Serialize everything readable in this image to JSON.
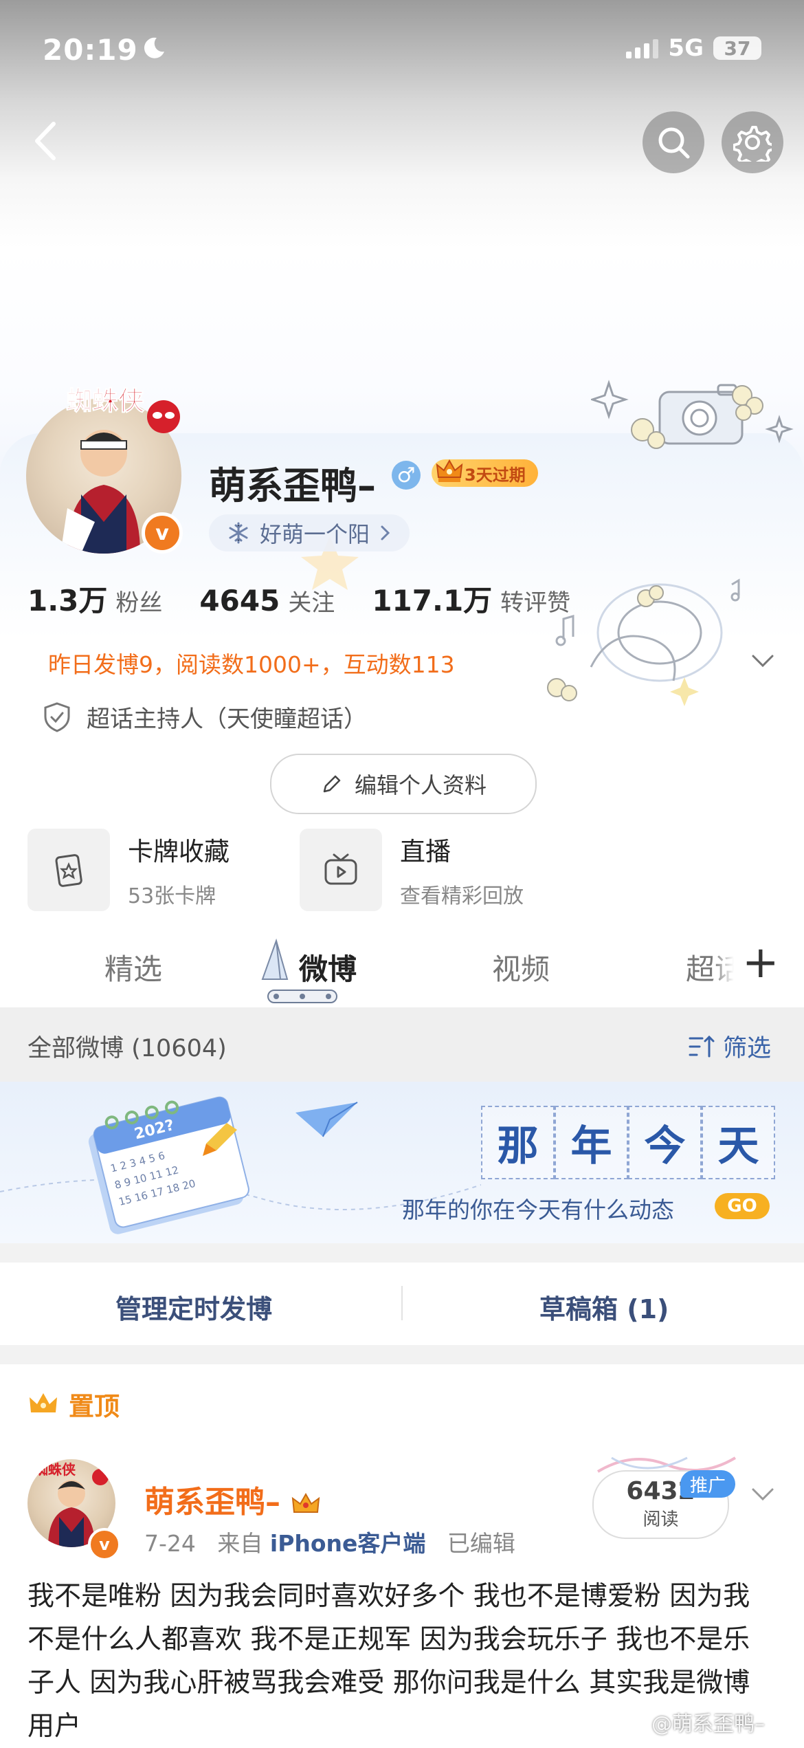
{
  "status_bar": {
    "time": "20:19",
    "network": "5G",
    "battery": "37"
  },
  "profile": {
    "name": "萌系歪鸭–",
    "gender_symbol": "♂",
    "vip_badge": "3天过期",
    "verified_mark": "v",
    "tag": "好萌一个阳",
    "stats": [
      {
        "value": "1.3万",
        "label": "粉丝"
      },
      {
        "value": "4645",
        "label": "关注"
      },
      {
        "value": "117.1万",
        "label": "转评赞"
      }
    ],
    "activity": "昨日发博9，阅读数1000+，互动数113",
    "host_role": "超话主持人（天使瞳超话）",
    "edit_button": "编辑个人资料"
  },
  "features": [
    {
      "title": "卡牌收藏",
      "subtitle": "53张卡牌",
      "icon": "card-icon"
    },
    {
      "title": "直播",
      "subtitle": "查看精彩回放",
      "icon": "tv-icon"
    }
  ],
  "tabs": [
    {
      "label": "精选"
    },
    {
      "label": "微博"
    },
    {
      "label": "视频"
    },
    {
      "label": "超话"
    }
  ],
  "tabs_more": "+",
  "filter": {
    "all_label": "全部微博 (10604)",
    "filter_label": "筛选"
  },
  "banner": {
    "grid_chars": [
      "那",
      "年",
      "今",
      "天"
    ],
    "subtitle": "那年的你在今天有什么动态",
    "go": "GO",
    "calendar_year": "202?",
    "calendar_days": "1 2 3 4 5 6 7 8 9 10 11 12 13 14 15 16 17 18 19 20"
  },
  "actions": {
    "scheduled": "管理定时发博",
    "drafts": "草稿箱 (1)"
  },
  "pinned_label": "置顶",
  "post": {
    "author": "萌系歪鸭–",
    "date": "7-24",
    "source_prefix": "来自",
    "source": "iPhone客户端",
    "edited": "已编辑",
    "reads_count": "6432",
    "reads_label": "阅读",
    "promo": "推广",
    "text": "我不是唯粉 因为我会同时喜欢好多个 我也不是博爱粉 因为我不是什么人都喜欢 我不是正规军 因为我会玩乐子 我也不是乐子人 因为我心肝被骂我会难受 那你问我是什么 其实我是微博用户"
  },
  "watermark": "@萌系歪鸭–",
  "colors": {
    "accent_orange": "#f26d1a",
    "link_blue": "#3b5b94",
    "go_yellow": "#f7b021"
  }
}
